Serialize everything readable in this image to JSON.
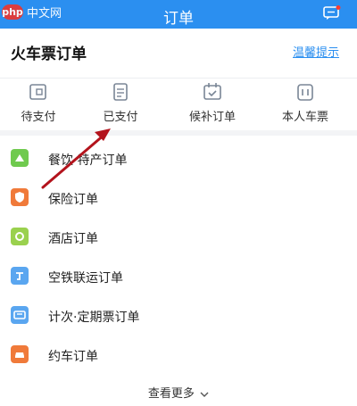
{
  "watermark": {
    "logo": "php",
    "text": "中文网"
  },
  "header": {
    "title": "订单"
  },
  "card": {
    "title": "火车票订单",
    "tip": "温馨提示"
  },
  "status_tabs": [
    {
      "label": "待支付",
      "icon": "pending-payment-icon"
    },
    {
      "label": "已支付",
      "icon": "paid-icon"
    },
    {
      "label": "候补订单",
      "icon": "waitlist-icon"
    },
    {
      "label": "本人车票",
      "icon": "my-ticket-icon"
    }
  ],
  "orders": [
    {
      "label": "餐饮·特产订单",
      "icon": "food-icon",
      "color": "#6fca4e"
    },
    {
      "label": "保险订单",
      "icon": "insurance-icon",
      "color": "#f07a3a"
    },
    {
      "label": "酒店订单",
      "icon": "hotel-icon",
      "color": "#9ad14e"
    },
    {
      "label": "空铁联运订单",
      "icon": "air-rail-icon",
      "color": "#5aa6f0"
    },
    {
      "label": "计次·定期票订单",
      "icon": "pass-ticket-icon",
      "color": "#5aa6f0"
    },
    {
      "label": "约车订单",
      "icon": "car-icon",
      "color": "#f07a3a"
    }
  ],
  "more": {
    "label": "查看更多"
  },
  "colors": {
    "brand": "#2b8ff0",
    "arrow": "#b3131c"
  }
}
